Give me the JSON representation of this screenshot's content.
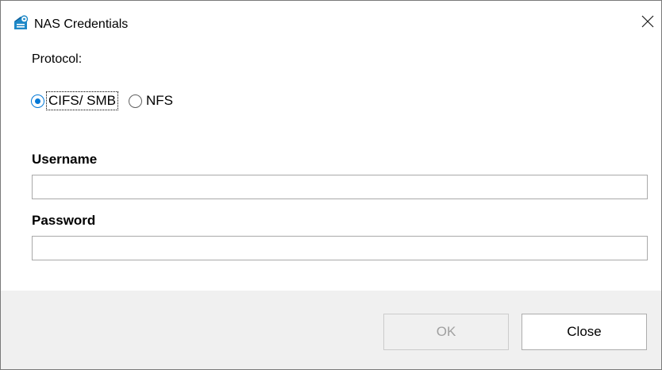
{
  "window": {
    "title": "NAS Credentials",
    "app_icon": "nas-cloud-icon",
    "close_icon": "close-icon"
  },
  "protocol": {
    "label": "Protocol:",
    "options": [
      {
        "label": "CIFS/ SMB",
        "selected": true
      },
      {
        "label": "NFS",
        "selected": false
      }
    ]
  },
  "username": {
    "label": "Username",
    "value": "",
    "placeholder": ""
  },
  "password": {
    "label": "Password",
    "value": "",
    "placeholder": ""
  },
  "buttons": {
    "ok_label": "OK",
    "ok_enabled": false,
    "close_label": "Close"
  },
  "colors": {
    "accent": "#0078d7",
    "footer_background": "#f0f0f0",
    "disabled_text": "#a0a0a0"
  }
}
